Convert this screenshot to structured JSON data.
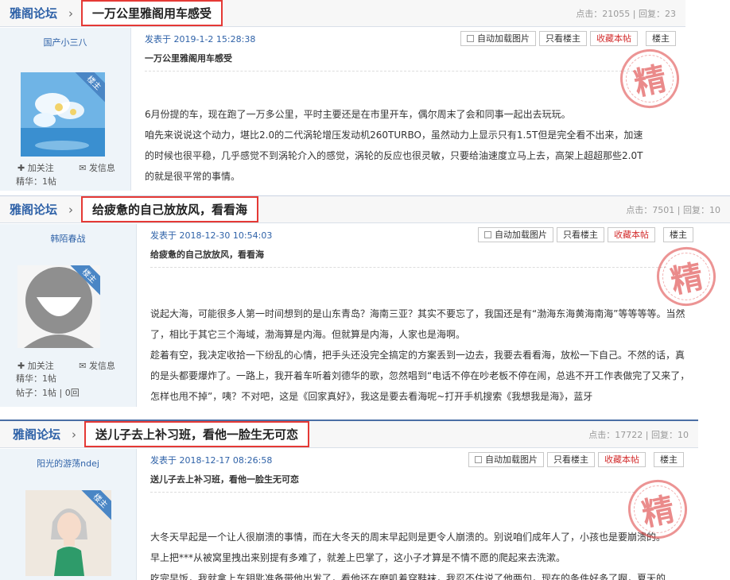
{
  "posts": [
    {
      "forum": "雅阁论坛",
      "title": "一万公里雅阁用车感受",
      "stats": "点击：21055 | 回复：23",
      "user": "国产小三八",
      "badge": "楼主",
      "follow": "加关注",
      "message": "发信息",
      "meta_line1": "精华：1帖",
      "meta_line2": "",
      "posted": "发表于 2019-1-2 15:28:38",
      "buttons": [
        "自动加载图片",
        "只看楼主",
        "收藏本帖",
        "楼主"
      ],
      "subject": "一万公里雅阁用车感受",
      "paragraphs": [
        "6月份提的车，现在跑了一万多公里，平时主要还是在市里开车，偶尔周末了会和同事一起出去玩玩。",
        "咱先来说说这个动力，堪比2.0的二代涡轮增压发动机260TURBO，虽然动力上显示只有1.5T但是完全看不出来，加速的时候也很平稳，几乎感觉不到涡轮介入的感觉，涡轮的反应也很灵敏，只要给油速度立马上去，高架上超超那些2.0T的就是很平常的事情。"
      ],
      "stamp": "精",
      "avatar": "flower-photo"
    },
    {
      "forum": "雅阁论坛",
      "title": "给疲惫的自己放放风，看看海",
      "stats": "点击：7501 | 回复：10",
      "user": "韩陌春战",
      "badge": "楼主",
      "follow": "加关注",
      "message": "发信息",
      "meta_line1": "精华：1帖",
      "meta_line2": "帖子：1帖 | 0回",
      "posted": "发表于 2018-12-30 10:54:03",
      "buttons": [
        "自动加载图片",
        "只看楼主",
        "收藏本帖",
        "楼主"
      ],
      "subject": "给疲惫的自己放放风，看看海",
      "paragraphs": [
        "说起大海，可能很多人第一时间想到的是山东青岛？海南三亚？其实不要忘了，我国还是有“渤海东海黄海南海”等等等等。当然了，相比于其它三个海域，渤海算是内海。但就算是内海，人家也是海啊。",
        "趁着有空，我决定收拾一下纷乱的心情，把手头还没完全搞定的方案丢到一边去，我要去看看海，放松一下自己。不然的话，真的是头都要爆炸了。一路上，我开着车听着刘德华的歌，忽然唱到“电话不停在吵老板不停在闹，总逃不开工作表做完了又来了，怎样也甩不掉”，咦？不对吧，这是《回家真好》，我这是要去看海呢~打开手机搜索《我想我是海》，蓝牙"
      ],
      "stamp": "精",
      "avatar": "default-user"
    },
    {
      "forum": "雅阁论坛",
      "title": "送儿子去上补习班，看他一脸生无可恋",
      "stats": "点击：17722 | 回复：10",
      "user": "阳光的游荡ndej",
      "badge": "楼主",
      "follow": "加关注",
      "message": "发信息",
      "meta_line1": "",
      "meta_line2": "",
      "posted": "发表于 2018-12-17 08:26:58",
      "buttons": [
        "自动加载图片",
        "只看楼主",
        "收藏本帖",
        "楼主"
      ],
      "subject": "送儿子去上补习班，看他一脸生无可恋",
      "paragraphs": [
        "大冬天早起是一个让人很崩溃的事情，而在大冬天的周末早起则是更令人崩溃的。别说咱们成年人了，小孩也是要崩溃的。",
        "早上把***从被窝里拽出来别提有多难了，就差上巴掌了，这小子才算是不情不愿的爬起来去洗漱。",
        "吃完早饭，我就拿上车钥匙准备带他出发了，看他还在磨叽着穿鞋袜，我忍不住说了他两句，现在的条件好多了啊，夏天的"
      ],
      "stamp": "精",
      "avatar": "cartoon-girl"
    }
  ],
  "colors": {
    "highlight": "#e53935",
    "link": "#2f62a8",
    "stamp": "#dc3c3c"
  }
}
